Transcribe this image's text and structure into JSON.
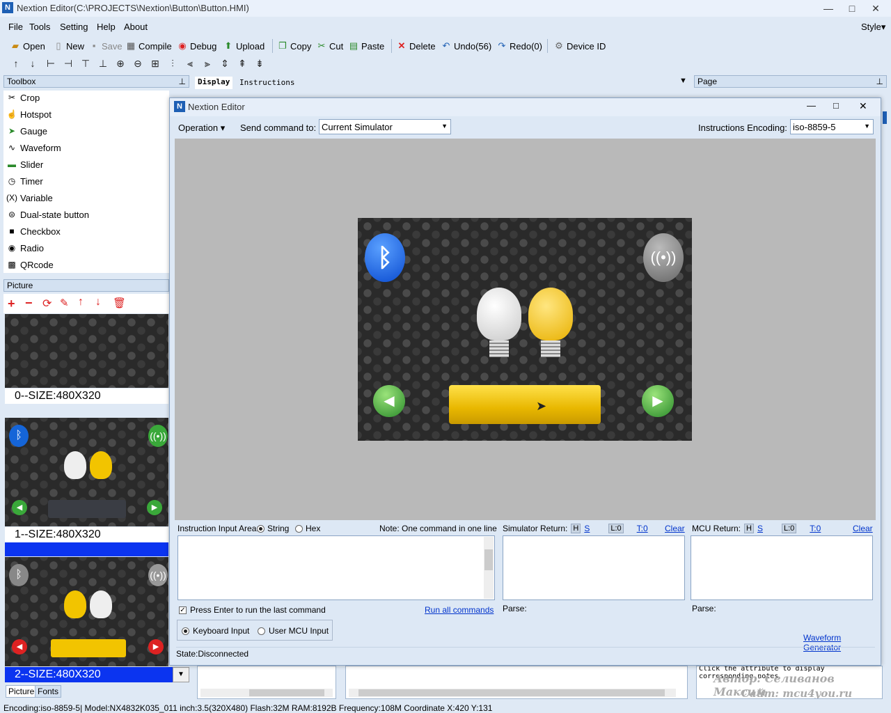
{
  "window": {
    "title": "Nextion Editor(C:\\PROJECTS\\Nextion\\Button\\Button.HMI)",
    "app_icon_glyph": "N",
    "minimize": "—",
    "maximize": "□",
    "close": "✕"
  },
  "menu": {
    "items": [
      "File",
      "Tools",
      "Setting",
      "Help",
      "About"
    ],
    "style": "Style▾"
  },
  "toolbar": {
    "open": "Open",
    "new": "New",
    "save": "Save",
    "compile": "Compile",
    "debug": "Debug",
    "upload": "Upload",
    "copy": "Copy",
    "cut": "Cut",
    "paste": "Paste",
    "delete": "Delete",
    "undo": "Undo(56)",
    "redo": "Redo(0)",
    "device_id": "Device  ID"
  },
  "toolbox": {
    "header": "Toolbox",
    "items": [
      "Crop",
      "Hotspot",
      "Gauge",
      "Waveform",
      "Slider",
      "Timer",
      "Variable",
      "Dual-state button",
      "Checkbox",
      "Radio",
      "QRcode"
    ]
  },
  "picture": {
    "header": "Picture",
    "items": [
      {
        "label": "0--SIZE:480X320"
      },
      {
        "label": "1--SIZE:480X320"
      },
      {
        "label": "2--SIZE:480X320"
      }
    ],
    "tabs": [
      "Picture",
      "Fonts"
    ]
  },
  "display_tabs": {
    "display": "Display",
    "instructions": "Instructions"
  },
  "page_panel": {
    "header": "Page"
  },
  "dialog": {
    "title": "Nextion Editor",
    "operation": "Operation ▾",
    "send_to_label": "Send command to:",
    "send_to_value": "Current Simulator",
    "encoding_label": "Instructions Encoding:",
    "encoding_value": "iso-8859-5",
    "instruction_label": "Instruction Input Area:",
    "string": "String",
    "hex": "Hex",
    "note": "Note: One command in one line",
    "sim_return": "Simulator Return:",
    "mcu_return": "MCU Return:",
    "h": "H",
    "s": "S",
    "l0": "L:0",
    "t0": "T:0",
    "clear": "Clear",
    "press_enter": "Press Enter to run the last command",
    "run_all": "Run all commands",
    "parse": "Parse:",
    "keyboard_input": "Keyboard Input",
    "user_mcu_input": "User MCU Input",
    "waveform_generator": "Waveform Generator",
    "state": "State:Disconnected"
  },
  "attribute_note": "Click the attribute to display corresponding notes",
  "watermark": {
    "line1": "Автор: Селиванов Максим",
    "line2": "Сайт: mcu4you.ru"
  },
  "statusbar": "Encoding:iso-8859-5| Model:NX4832K035_011  inch:3.5(320X480) Flash:32M RAM:8192B Frequency:108M    Coordinate X:420  Y:131",
  "colors": {
    "accent": "#1e5fb4",
    "button_yellow": "#f2c400",
    "green_arrow": "#3aa83a",
    "bt_blue": "#1565d8"
  }
}
